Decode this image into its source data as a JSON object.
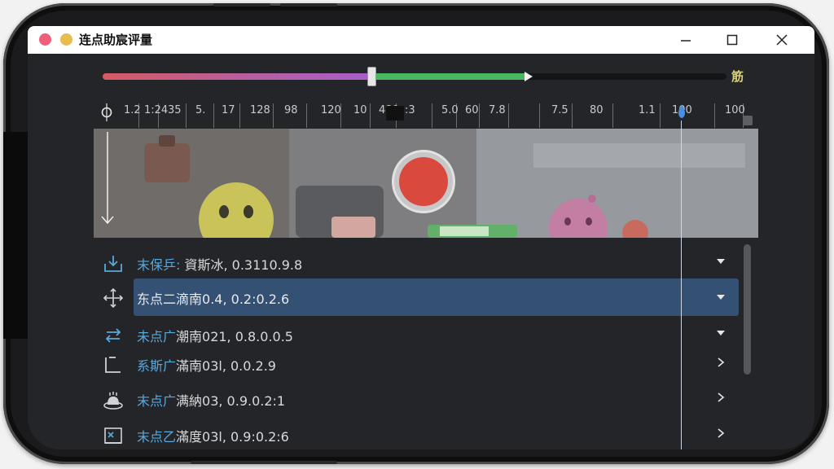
{
  "window": {
    "title": "连点助宸评量"
  },
  "slider": {
    "end_label": "筋",
    "colors": {
      "segment_a": "#c75e8c",
      "segment_b": "#47b85f",
      "track": "#141517"
    }
  },
  "ruler": {
    "labels": [
      "1.2",
      "1:24",
      "35",
      "5.",
      "17",
      "128",
      "98",
      "120",
      "10",
      "480",
      ":3",
      "5.0",
      "60",
      "7.8",
      "7.5",
      "80",
      "1.1",
      "100",
      "100"
    ]
  },
  "rows": [
    {
      "prefix": "末保乒:",
      "text": " 資斯冰, 0.3110.9.8",
      "icon": "download-tray-icon",
      "chevron": "dropdown",
      "selected": false
    },
    {
      "prefix": "东点二",
      "text": "滴南0.4, 0.2:0.2.6",
      "icon": "move-arrows-icon",
      "chevron": "dropdown",
      "selected": true
    },
    {
      "prefix": "未点广",
      "text": "潮南021, 0.8.0.0.5",
      "icon": "swap-arrows-icon",
      "chevron": "dropdown",
      "selected": false
    },
    {
      "prefix": "系斯广",
      "text": "滿南03l, 0.0.2.9",
      "icon": "corner-bracket-icon",
      "chevron": "expand",
      "selected": false
    },
    {
      "prefix": "末点广",
      "text": "满納03, 0.9.0.2:1",
      "icon": "bell-cake-icon",
      "chevron": "expand",
      "selected": false
    },
    {
      "prefix": "末点乙",
      "text": "滿度03l, 0.9:0.2:6",
      "icon": "picture-frame-icon",
      "chevron": "expand",
      "selected": false
    }
  ]
}
